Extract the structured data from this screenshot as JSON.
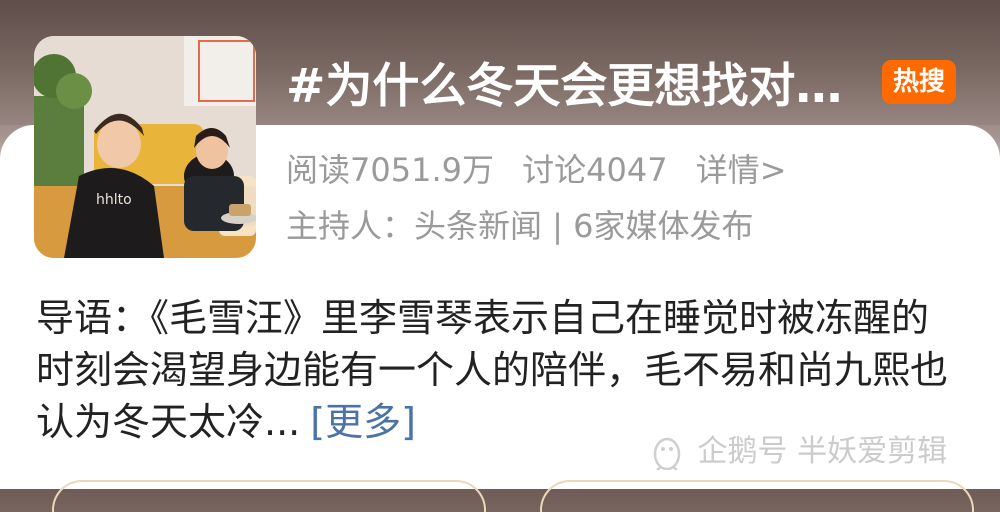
{
  "topic": {
    "title": "#为什么冬天会更想找对…",
    "badge": "热搜"
  },
  "stats": {
    "reads": "阅读7051.9万",
    "discussions": "讨论4047",
    "details": "详情>"
  },
  "host_line": "主持人：头条新闻 | 6家媒体发布",
  "intro": {
    "text": "导语：《毛雪汪》里李雪琴表示自己在睡觉时被冻醒的时刻会渴望身边能有一个人的陪伴，毛不易和尚九熙也认为冬天太冷...",
    "more": "[更多]"
  },
  "watermark": "企鹅号 半妖爱剪辑",
  "thumbnail": {
    "shirt_text": "hhlto"
  },
  "colors": {
    "badge": "#ff6a00",
    "link": "#4a73a8",
    "meta": "#9a9a9a"
  }
}
